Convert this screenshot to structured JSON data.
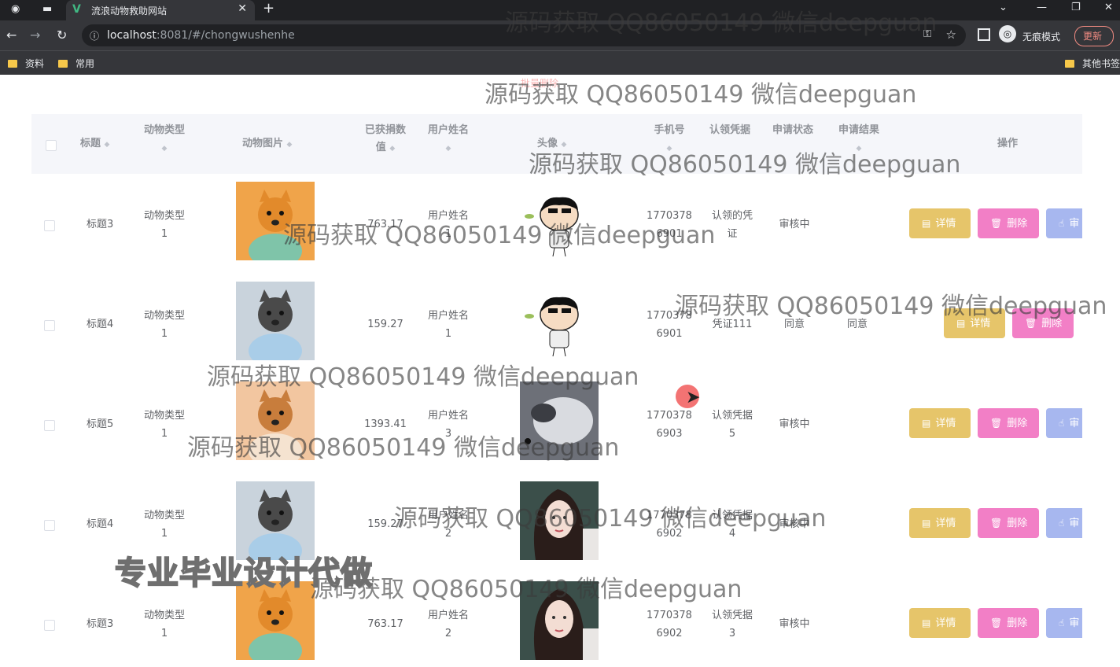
{
  "browser": {
    "tab_title": "流浪动物救助网站",
    "url_host": "localhost",
    "url_port_path": ":8081/#/chongwushenhe",
    "incognito_label": "无痕模式",
    "update_label": "更新",
    "bookmarks": [
      "资料",
      "常用"
    ],
    "other_bookmarks": "其他书签"
  },
  "page": {
    "ghost_button": "批量删除",
    "columns": [
      "标题",
      "动物类型",
      "动物图片",
      "已获捐数值",
      "用户姓名",
      "头像",
      "手机号",
      "认领凭据",
      "申请状态",
      "申请结果",
      "操作"
    ],
    "columns_split": {
      "donated_1": "已获捐数",
      "donated_2": "值"
    },
    "rows": [
      {
        "title": "标题3",
        "type_1": "动物类型",
        "type_2": "1",
        "donated": "763.17",
        "user_1": "用户姓名",
        "user_2": "1",
        "phone_1": "1770378",
        "phone_2": "6901",
        "proof_1": "认领的凭",
        "proof_2": "证",
        "status": "审核中",
        "result": "",
        "photo": "pomeranian",
        "avatar": "cartoon-boy"
      },
      {
        "title": "标题4",
        "type_1": "动物类型",
        "type_2": "1",
        "donated": "159.27",
        "user_1": "用户姓名",
        "user_2": "1",
        "phone_1": "1770378",
        "phone_2": "6901",
        "proof_1": "凭证111",
        "proof_2": "",
        "status": "同意",
        "result": "同意",
        "photo": "schnauzer",
        "avatar": "cartoon-boy"
      },
      {
        "title": "标题5",
        "type_1": "动物类型",
        "type_2": "1",
        "donated": "1393.41",
        "user_1": "用户姓名",
        "user_2": "3",
        "phone_1": "1770378",
        "phone_2": "6903",
        "proof_1": "认领凭据",
        "proof_2": "5",
        "status": "审核中",
        "result": "",
        "photo": "corgi",
        "avatar": "husky"
      },
      {
        "title": "标题4",
        "type_1": "动物类型",
        "type_2": "1",
        "donated": "159.27",
        "user_1": "用户姓名",
        "user_2": "2",
        "phone_1": "1770378",
        "phone_2": "6902",
        "proof_1": "认领凭据",
        "proof_2": "4",
        "status": "审核中",
        "result": "",
        "photo": "schnauzer",
        "avatar": "girl"
      },
      {
        "title": "标题3",
        "type_1": "动物类型",
        "type_2": "1",
        "donated": "763.17",
        "user_1": "用户姓名",
        "user_2": "2",
        "phone_1": "1770378",
        "phone_2": "6902",
        "proof_1": "认领凭据",
        "proof_2": "3",
        "status": "审核中",
        "result": "",
        "photo": "pomeranian",
        "avatar": "girl"
      }
    ],
    "actions": {
      "detail": "详情",
      "delete": "删除",
      "audit": "审"
    }
  },
  "overlay": {
    "watermark": "源码获取 QQ86050149 微信deepguan",
    "promo": "专业毕业设计代做"
  },
  "colors": {
    "detail": "#e6c56a",
    "delete": "#f27fc6",
    "audit": "#a7b7ef",
    "header_bg": "#f5f6fa"
  }
}
